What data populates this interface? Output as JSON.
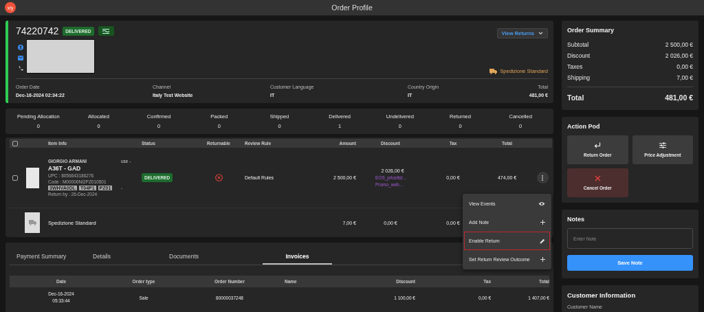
{
  "top_bar": {
    "logo": "x/y",
    "title": "Order Profile"
  },
  "order": {
    "number": "74220742",
    "status": "DELIVERED",
    "view_returns": "View Returns",
    "shipping_method": "Spedizione Standard",
    "fields": [
      {
        "label": "Order Date",
        "value": "Dec-16-2024 02:34:22"
      },
      {
        "label": "Channel",
        "value": "Italy Test Website"
      },
      {
        "label": "Customer Language",
        "value": "IT"
      },
      {
        "label": "Country Origin",
        "value": "IT"
      },
      {
        "label": "Total",
        "value": "481,00 €"
      }
    ]
  },
  "fulfillment_counts": [
    {
      "label": "Pending Allocation",
      "value": "0"
    },
    {
      "label": "Allocated",
      "value": "0"
    },
    {
      "label": "Confirmed",
      "value": "0"
    },
    {
      "label": "Packed",
      "value": "0"
    },
    {
      "label": "Shipped",
      "value": "0"
    },
    {
      "label": "Delivered",
      "value": "1"
    },
    {
      "label": "Undelivered",
      "value": "0"
    },
    {
      "label": "Returned",
      "value": "0"
    },
    {
      "label": "Cancelled",
      "value": "0"
    }
  ],
  "items_table": {
    "header_checked": false,
    "columns": [
      "Item Info",
      "Status",
      "Returnable",
      "Review Rule",
      "Amount",
      "Discount",
      "Tax",
      "Total"
    ],
    "rows": [
      {
        "kind": "product",
        "checked": false,
        "brand": "GIORGIO ARMANI",
        "name": "A36T - GAD",
        "upc": "UPC : 8056643186276",
        "code": "Code : M00000NI2PZ010501",
        "tags": [
          "3WHVA0DL",
          "T04P1",
          "PZ01"
        ],
        "return_by": "Return by : 26-Dec-2024",
        "unlabeled_column": [
          "use -",
          "-"
        ],
        "status": "DELIVERED",
        "returnable": false,
        "review_rule": "Default Rules",
        "amount": "2 500,00 €",
        "discount": "2 026,00 €",
        "promotions": [
          "EOS_pricelist...",
          "Promo_web..."
        ],
        "tax": "0,00 €",
        "total": "474,00 €"
      },
      {
        "kind": "shipping",
        "name": "Spedizione Standard",
        "amount": "7,00 €",
        "discount": "0,00 €",
        "tax": "0,00 €"
      }
    ]
  },
  "row_menu": {
    "items": [
      {
        "label": "View Events",
        "kind": "eye",
        "highlighted": false
      },
      {
        "label": "Add Note",
        "kind": "plus",
        "highlighted": false
      },
      {
        "label": "Enable Return",
        "kind": "pencil",
        "highlighted": true
      },
      {
        "label": "Set Return Review Outcome",
        "kind": "plus",
        "highlighted": false
      }
    ]
  },
  "tabs": [
    {
      "label": "Payment Summary",
      "selected": false
    },
    {
      "label": "Details",
      "selected": false
    },
    {
      "label": "Documents",
      "selected": false
    },
    {
      "label": "Invoices",
      "selected": true
    }
  ],
  "invoices": {
    "columns": [
      "Date",
      "Order type",
      "Order Number",
      "Name",
      "Discount",
      "Tax",
      "Total"
    ],
    "rows": [
      {
        "date": "Dec-16-2024 05:33:44",
        "order_type": "Sale",
        "order_number": "80000037248",
        "discount": "1 100,00 €",
        "tax": "0,00 €",
        "total": "1 407,00 €"
      }
    ]
  },
  "order_summary": {
    "title": "Order Summary",
    "rows": [
      {
        "label": "Subtotal",
        "value": "2 500,00 €"
      },
      {
        "label": "Discount",
        "value": "2 026,00 €"
      },
      {
        "label": "Taxes",
        "value": "0,00 €"
      },
      {
        "label": "Shipping",
        "value": "7,00 €"
      }
    ],
    "total": {
      "label": "Total",
      "value": "481,00 €"
    }
  },
  "action_pod": {
    "title": "Action Pod",
    "buttons": [
      {
        "label": "Return Order",
        "kind": "return"
      },
      {
        "label": "Price Adjustment",
        "kind": "adjust"
      },
      {
        "label": "Cancel Order",
        "kind": "cancel"
      }
    ]
  },
  "notes": {
    "title": "Notes",
    "placeholder": "Enter Note",
    "button": "Save Note"
  },
  "customer_information": {
    "title": "Customer Information",
    "first_label": "Customer Name"
  }
}
